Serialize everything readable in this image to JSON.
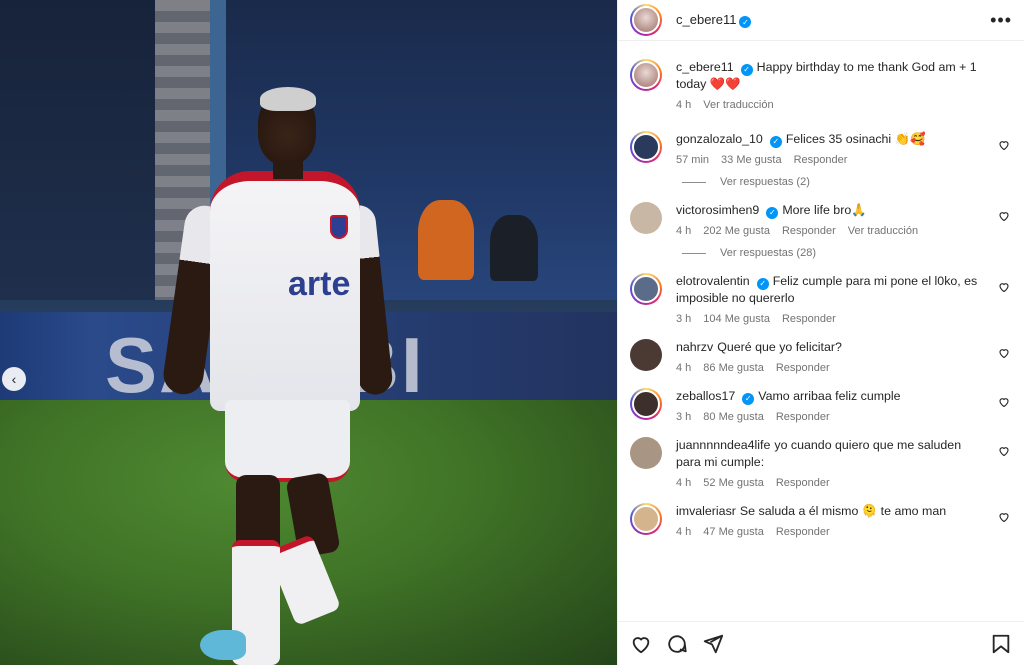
{
  "post": {
    "author": "c_ebere11",
    "carousel_prev_glyph": "‹"
  },
  "photo": {
    "billboard_text": "SAMBBI",
    "jersey_sponsor": "arte"
  },
  "caption": {
    "username": "c_ebere11",
    "text": "Happy birthday to me thank God am + 1 today ❤️❤️",
    "time": "4 h",
    "translate": "Ver traducción"
  },
  "comments": [
    {
      "username": "gonzalozalo_10",
      "verified": true,
      "text": "Felices 35 osinachi 👏🥰",
      "time": "57 min",
      "likes": "33 Me gusta",
      "reply": "Responder",
      "translate": "",
      "replies": "Ver respuestas (2)",
      "avatar_color": "#2b3a5c"
    },
    {
      "username": "victorosimhen9",
      "verified": true,
      "text": "More life bro🙏",
      "time": "4 h",
      "likes": "202 Me gusta",
      "reply": "Responder",
      "translate": "Ver traducción",
      "replies": "Ver respuestas (28)",
      "avatar_color": "#c9b7a6"
    },
    {
      "username": "elotrovalentin",
      "verified": true,
      "text": "Feliz cumple para mi pone el l0ko, es imposible no quererlo",
      "time": "3 h",
      "likes": "104 Me gusta",
      "reply": "Responder",
      "translate": "",
      "replies": "",
      "avatar_color": "#5b6b8a"
    },
    {
      "username": "nahrzv",
      "verified": false,
      "text": "Queré que yo felicitar?",
      "time": "4 h",
      "likes": "86 Me gusta",
      "reply": "Responder",
      "translate": "",
      "replies": "",
      "avatar_color": "#4a3a33"
    },
    {
      "username": "zeballos17",
      "verified": true,
      "text": "Vamo arribaa feliz cumple",
      "time": "3 h",
      "likes": "80 Me gusta",
      "reply": "Responder",
      "translate": "",
      "replies": "",
      "avatar_color": "#3d2f2a"
    },
    {
      "username": "juannnnndea4life",
      "verified": false,
      "text": "yo cuando quiero que me saluden para mi cumple:",
      "time": "4 h",
      "likes": "52 Me gusta",
      "reply": "Responder",
      "translate": "",
      "replies": "",
      "avatar_color": "#a89584"
    },
    {
      "username": "imvaleriasr",
      "verified": false,
      "text": "Se saluda a él mismo 🫠 te amo man",
      "time": "4 h",
      "likes": "47 Me gusta",
      "reply": "Responder",
      "translate": "",
      "replies": "",
      "avatar_color": "#d4b48c"
    }
  ],
  "colors": {
    "verified": "#0095f6",
    "text": "#262626",
    "meta": "#737373"
  },
  "icons": {
    "like": "heart-icon",
    "comment": "comment-icon",
    "share": "share-icon",
    "save": "bookmark-icon",
    "more": "more-options-icon"
  }
}
